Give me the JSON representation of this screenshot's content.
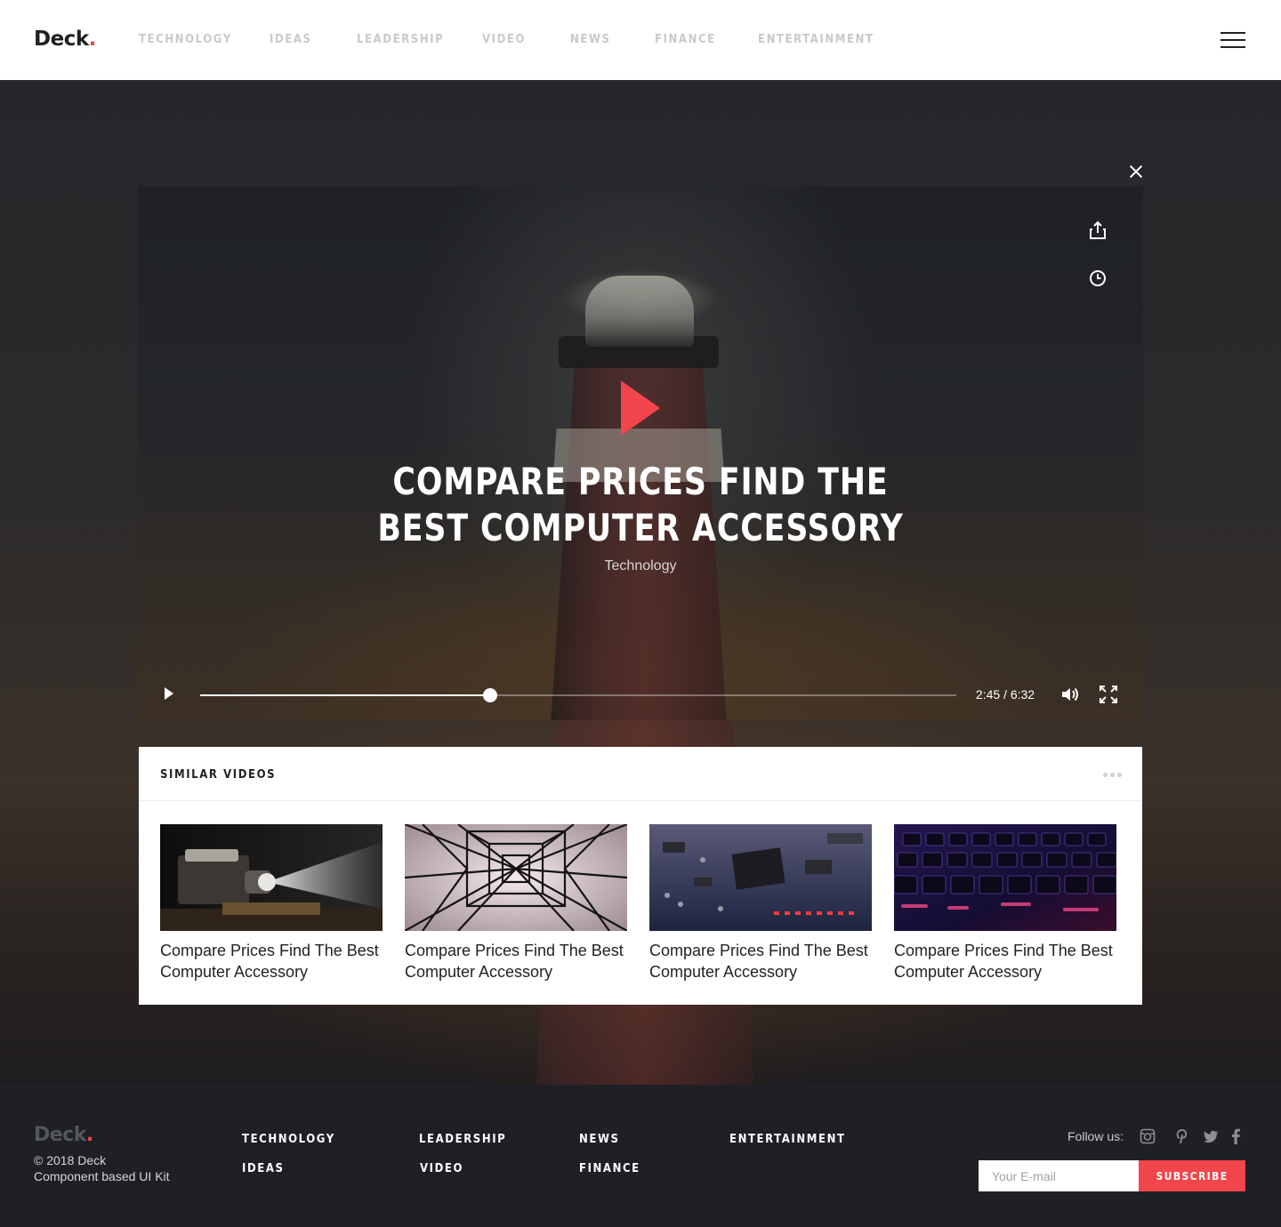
{
  "header": {
    "logo": "Deck",
    "logo_dot": ".",
    "nav": [
      "TECHNOLOGY",
      "IDEAS",
      "LEADERSHIP",
      "VIDEO",
      "NEWS",
      "FINANCE",
      "ENTERTAINMENT"
    ]
  },
  "player": {
    "title": "COMPARE PRICES FIND THE BEST COMPUTER ACCESSORY",
    "category": "Technology",
    "time": "2:45 / 6:32",
    "progress": 0.384
  },
  "similar": {
    "title": "SIMILAR VIDEOS",
    "items": [
      {
        "title": "Compare Prices Find The Best Computer Accessory",
        "thumb": "projector"
      },
      {
        "title": "Compare Prices Find The Best Computer Accessory",
        "thumb": "power-tower"
      },
      {
        "title": "Compare Prices Find The Best Computer Accessory",
        "thumb": "circuit-board"
      },
      {
        "title": "Compare Prices Find The Best Computer Accessory",
        "thumb": "keyboard"
      }
    ]
  },
  "footer": {
    "logo": "Deck",
    "logo_dot": ".",
    "copyright": "© 2018 Deck",
    "tagline": "Component based UI Kit",
    "links": {
      "technology": "TECHNOLOGY",
      "ideas": "IDEAS",
      "leadership": "LEADERSHIP",
      "video": "VIDEO",
      "news": "NEWS",
      "finance": "FINANCE",
      "entertainment": "ENTERTAINMENT"
    },
    "follow_label": "Follow us:",
    "social": [
      "instagram-icon",
      "pinterest-icon",
      "twitter-icon",
      "facebook-icon"
    ],
    "email_placeholder": "Your E-mail",
    "subscribe_label": "SUBSCRIBE"
  },
  "colors": {
    "accent": "#f2454c",
    "footer_bg": "#1f2026"
  }
}
